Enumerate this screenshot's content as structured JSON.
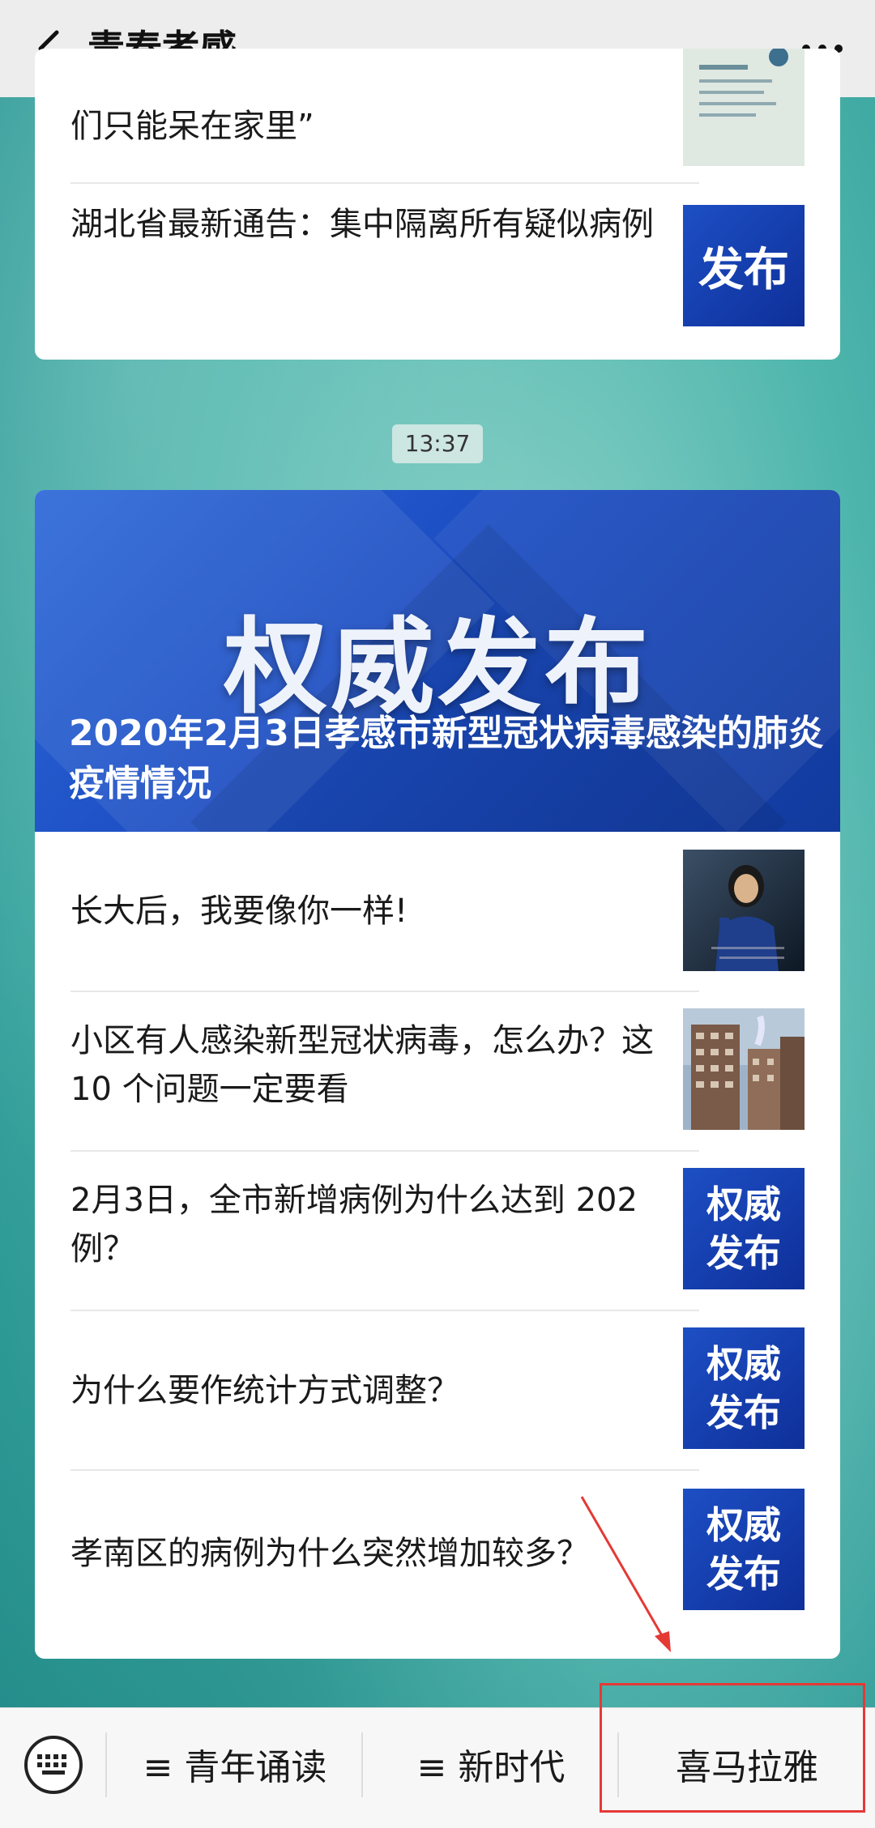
{
  "header": {
    "title": "青春孝感"
  },
  "feed_card_1": {
    "items": [
      {
        "text": "们只能呆在家里”",
        "thumb": "poster-icon"
      },
      {
        "text": "湖北省最新通告：集中隔离所有疑似病例",
        "thumb_text": "发布"
      }
    ]
  },
  "timestamp": "13:37",
  "feed_card_2": {
    "banner": {
      "logo_text": "权威发布",
      "title": "2020年2月3日孝感市新型冠状病毒感染的肺炎疫情情况"
    },
    "items": [
      {
        "text": "长大后，我要像你一样!",
        "thumb": "person-photo"
      },
      {
        "text": "小区有人感染新型冠状病毒，怎么办？这 10 个问题一定要看",
        "thumb": "building-photo"
      },
      {
        "text": "2月3日，全市新增病例为什么达到 202 例？",
        "thumb_text_1": "权威",
        "thumb_text_2": "发布"
      },
      {
        "text": "为什么要作统计方式调整？",
        "thumb_text_1": "权威",
        "thumb_text_2": "发布"
      },
      {
        "text": "孝南区的病例为什么突然增加较多？",
        "thumb_text_1": "权威",
        "thumb_text_2": "发布"
      }
    ]
  },
  "bottom_menu": {
    "items": [
      {
        "label": "≡ 青年诵读"
      },
      {
        "label": "≡ 新时代"
      },
      {
        "label": "喜马拉雅"
      }
    ]
  },
  "colors": {
    "accent_blue": "#1d4fc4",
    "annotation_red": "#e53935"
  }
}
